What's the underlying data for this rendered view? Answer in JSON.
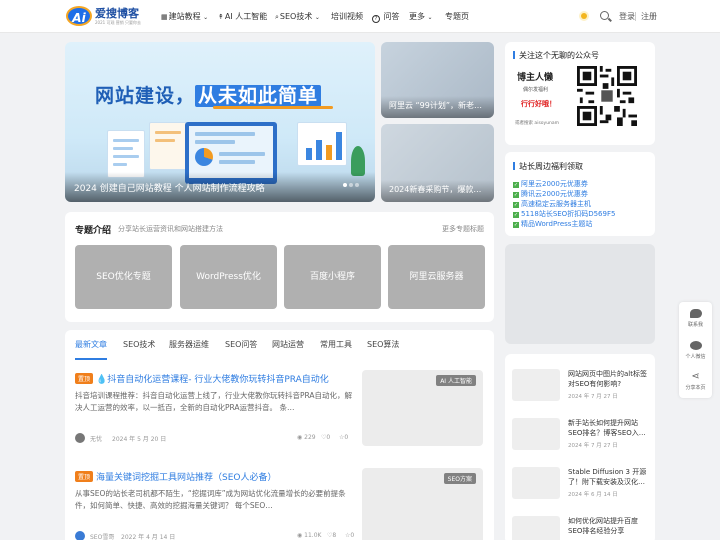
{
  "brand": {
    "name": "爱搜博客",
    "sub": "2021 可观 营销  只要你去"
  },
  "nav": [
    {
      "icon": "grid-icon",
      "glyph": "▦",
      "label": "建站教程",
      "chevron": true
    },
    {
      "icon": "pin-icon",
      "glyph": "↟",
      "label": "AI 人工智能",
      "chevron": false
    },
    {
      "icon": "search-icon",
      "glyph": "⌕",
      "label": "SEO技术",
      "chevron": true
    },
    {
      "icon": "",
      "glyph": "",
      "label": "培训视频",
      "chevron": false
    },
    {
      "icon": "question-icon",
      "glyph": "❓",
      "label": "问答",
      "chevron": false
    },
    {
      "icon": "",
      "glyph": "",
      "label": "更多",
      "chevron": true
    },
    {
      "icon": "",
      "glyph": "",
      "label": "专题页",
      "chevron": false
    }
  ],
  "topright": {
    "login": "登录",
    "register": "注册"
  },
  "hero": {
    "title_a": "网站建设，",
    "title_b": "从未如此简单",
    "caption": "2024 创建自己网站教程 个人网站制作流程攻略"
  },
  "side_cards": [
    {
      "caption": "阿里云 “99计划”，新老…"
    },
    {
      "caption": "2024新春采购节，爆款…"
    }
  ],
  "topics": {
    "title": "专题介绍",
    "sub": "分享站长运营资讯和网站搭建方法",
    "more": "更多专题标题",
    "items": [
      "SEO优化专题",
      "WordPress优化",
      "百度小程序",
      "阿里云服务器"
    ]
  },
  "tabs": [
    "最新文章",
    "SEO技术",
    "服务器运维",
    "SEO问答",
    "网站运营",
    "常用工具",
    "SEO算法"
  ],
  "posts": [
    {
      "badge": "置顶",
      "title": "💧抖音自动化运营课程- 行业大佬教你玩转抖音PRA自动化",
      "excerpt": "抖音培训课程推荐：抖音自动化运营上线了，行业大佬教你玩转抖音PRA自动化，解决人工运营的效率，以一抵百，全新的自动化PRA运营抖音。 条…",
      "author": "无忧",
      "date": "2024 年 5 月 20 日",
      "views": "229",
      "likes": "0",
      "favs": "0",
      "tag": "AI 人工智能"
    },
    {
      "badge": "置顶",
      "title": "海量关键词挖掘工具网站推荐（SEO人必备）",
      "excerpt": "从事SEO的站长老司机都不陌生，“挖掘词库”成为网站优化流量增长的必要前提条件，如何简单、快捷、高效的挖掘海量关键词？ 每个SEO…",
      "author": "SEO雪哥",
      "date": "2022 年 4 月 14 日",
      "views": "11.0K",
      "likes": "8",
      "favs": "0",
      "tag": "SEO方案"
    }
  ],
  "widget_wechat": {
    "title": "关注这个无聊的公众号",
    "name": "博主人懒",
    "line2": "偶尔发福利",
    "line3": "行行好哦！",
    "line4": "或者搜索 aisoyunam"
  },
  "widget_welfare": {
    "title": "站长周边福利领取",
    "items": [
      "阿里云2000元优惠券",
      "腾讯云2000元优惠券",
      "高速稳定云服务器主机",
      "5118站长SEO折扣码D569F5",
      "精品WordPress主题站"
    ]
  },
  "recent": [
    {
      "title": "网站网页中图片的alt标签对SEO有何影响?",
      "date": "2024 年 7 月 27 日"
    },
    {
      "title": "新手站长如何提升网站SEO排名？博客SEO入…",
      "date": "2024 年 7 月 27 日"
    },
    {
      "title": "Stable Diffusion 3 开源了！附下载安装及汉化…",
      "date": "2024 年 6 月 14 日"
    },
    {
      "title": "如何优化网站提升百度SEO排名经验分享",
      "date": ""
    }
  ],
  "float_bar": {
    "contact": "联系我",
    "wechat": "个人微信",
    "share": "分享本页"
  }
}
